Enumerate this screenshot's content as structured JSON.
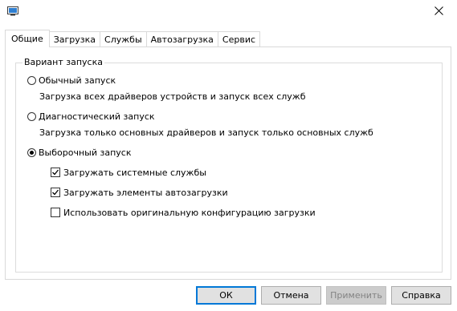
{
  "window": {
    "title": ""
  },
  "tabs": [
    {
      "label": "Общие",
      "active": true
    },
    {
      "label": "Загрузка",
      "active": false
    },
    {
      "label": "Службы",
      "active": false
    },
    {
      "label": "Автозагрузка",
      "active": false
    },
    {
      "label": "Сервис",
      "active": false
    }
  ],
  "startup": {
    "group_label": "Вариант запуска",
    "normal": {
      "label": "Обычный запуск",
      "description": "Загрузка всех драйверов устройств и запуск всех служб",
      "selected": false
    },
    "diagnostic": {
      "label": "Диагностический запуск",
      "description": "Загрузка только основных драйверов и запуск только основных служб",
      "selected": false
    },
    "selective": {
      "label": "Выборочный запуск",
      "selected": true,
      "options": [
        {
          "label": "Загружать системные службы",
          "checked": true
        },
        {
          "label": "Загружать элементы автозагрузки",
          "checked": true
        },
        {
          "label": "Использовать оригинальную конфигурацию загрузки",
          "checked": false
        }
      ]
    }
  },
  "buttons": {
    "ok": "ОК",
    "cancel": "Отмена",
    "apply": "Применить",
    "help": "Справка"
  },
  "icons": {
    "app": "msconfig-icon",
    "close": "close-icon",
    "check": "checkmark-icon"
  },
  "colors": {
    "accent": "#0078d7",
    "border": "#d9d9d9",
    "button_bg": "#e1e1e1",
    "disabled_text": "#838383"
  }
}
